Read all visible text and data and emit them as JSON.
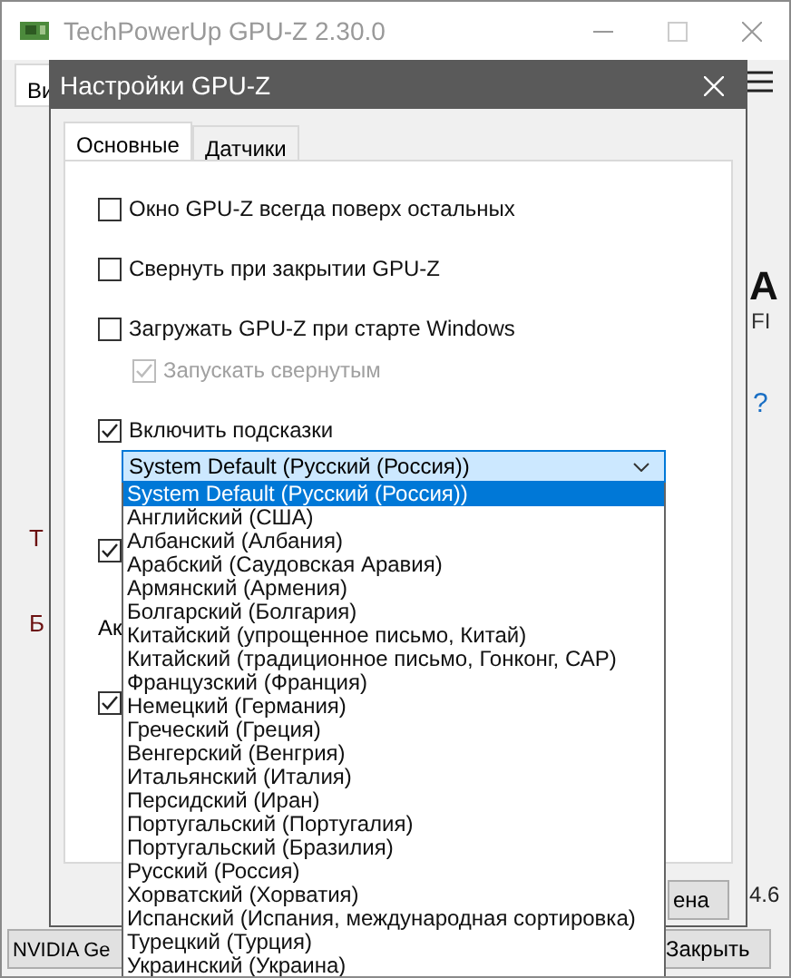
{
  "main_window": {
    "title": "TechPowerUp GPU-Z 2.30.0",
    "tab_fragment": "Ви",
    "logo_fragment": "A",
    "text_fragment": "FI",
    "help_mark": "?",
    "left_fragments": [
      "T",
      "Б"
    ],
    "version_fragment": "4.6",
    "gpu_select": {
      "value": "NVIDIA Ge"
    },
    "close_button": "Закрыть"
  },
  "dialog": {
    "title": "Настройки GPU-Z",
    "tabs": [
      {
        "label": "Основные",
        "selected": true
      },
      {
        "label": "Датчики",
        "selected": false
      }
    ],
    "options": [
      {
        "label": "Окно GPU-Z всегда поверх остальных",
        "checked": false,
        "disabled": false
      },
      {
        "label": "Свернуть при закрытии GPU-Z",
        "checked": false,
        "disabled": false
      },
      {
        "label": "Загружать GPU-Z при старте Windows",
        "checked": false,
        "disabled": false,
        "children": [
          {
            "label": "Запускать свернутым",
            "checked": true,
            "disabled": true
          }
        ]
      },
      {
        "label": "Включить подсказки",
        "checked": true,
        "disabled": false
      }
    ],
    "language_select": {
      "value": "System Default (Русский (Россия))",
      "expanded": true,
      "options": [
        {
          "label": "System Default (Русский (Россия))",
          "selected": true
        },
        {
          "label": "Английский (США)",
          "selected": false
        },
        {
          "label": "Албанский (Албания)",
          "selected": false
        },
        {
          "label": "Арабский (Саудовская Аравия)",
          "selected": false
        },
        {
          "label": "Армянский (Армения)",
          "selected": false
        },
        {
          "label": "Болгарский (Болгария)",
          "selected": false
        },
        {
          "label": "Китайский (упрощенное письмо, Китай)",
          "selected": false
        },
        {
          "label": "Китайский (традиционное письмо, Гонконг, САР)",
          "selected": false
        },
        {
          "label": "Французский (Франция)",
          "selected": false
        },
        {
          "label": "Немецкий (Германия)",
          "selected": false
        },
        {
          "label": "Греческий (Греция)",
          "selected": false
        },
        {
          "label": "Венгерский (Венгрия)",
          "selected": false
        },
        {
          "label": "Итальянский (Италия)",
          "selected": false
        },
        {
          "label": "Персидский (Иран)",
          "selected": false
        },
        {
          "label": "Португальский (Португалия)",
          "selected": false
        },
        {
          "label": "Португальский (Бразилия)",
          "selected": false
        },
        {
          "label": "Русский (Россия)",
          "selected": false
        },
        {
          "label": "Хорватский (Хорватия)",
          "selected": false
        },
        {
          "label": "Испанский (Испания, международная сортировка)",
          "selected": false
        },
        {
          "label": "Турецкий (Турция)",
          "selected": false
        },
        {
          "label": "Украинский (Украина)",
          "selected": false
        }
      ]
    },
    "hidden_checkboxes": [
      {
        "checked": true
      },
      {
        "checked": true
      }
    ],
    "label_fragment": "Ак",
    "cancel_button_fragment": "ена"
  }
}
